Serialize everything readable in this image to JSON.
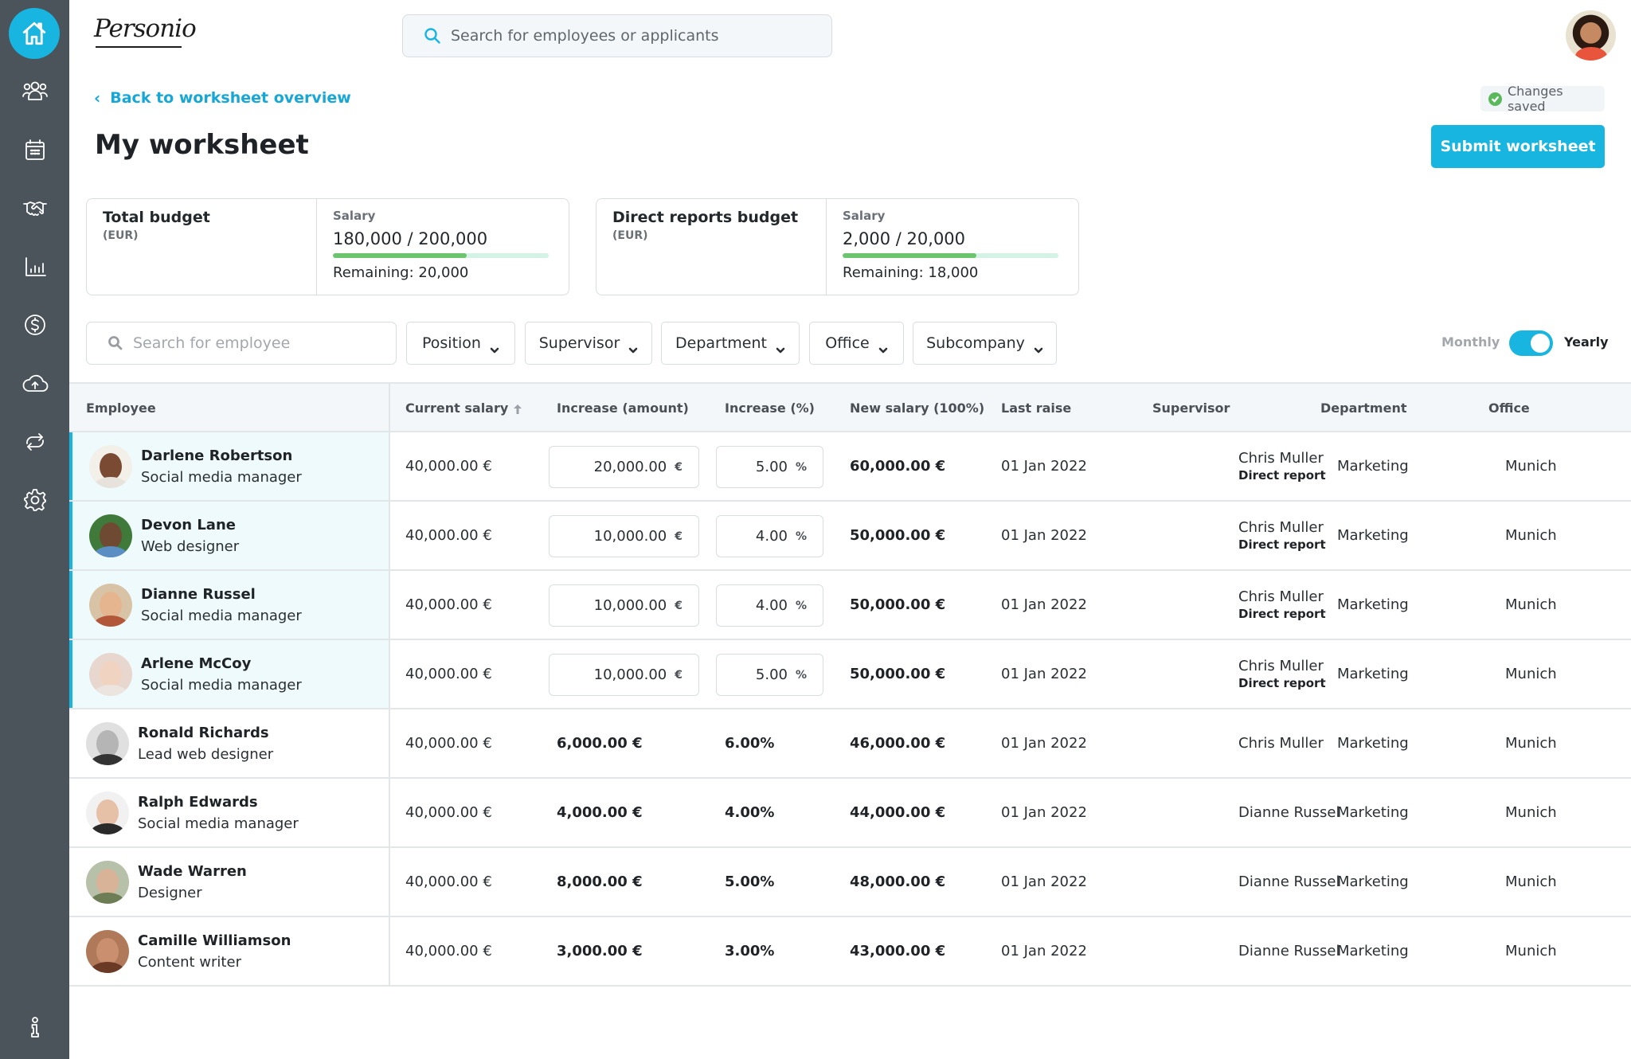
{
  "app": {
    "brand": "Personio",
    "search_placeholder": "Search for employees or applicants"
  },
  "sidebar": {
    "items": [
      {
        "name": "home",
        "icon": "home-icon",
        "active": true
      },
      {
        "name": "employees",
        "icon": "people-icon"
      },
      {
        "name": "calendar",
        "icon": "calendar-icon"
      },
      {
        "name": "recruiting",
        "icon": "handshake-icon"
      },
      {
        "name": "reports",
        "icon": "bar-chart-icon"
      },
      {
        "name": "payroll",
        "icon": "dollar-icon"
      },
      {
        "name": "upload",
        "icon": "cloud-upload-icon"
      },
      {
        "name": "sync",
        "icon": "sync-icon"
      },
      {
        "name": "settings",
        "icon": "gear-icon"
      }
    ],
    "footer_icon": "info-icon"
  },
  "header": {
    "back_label": "Back to worksheet overview",
    "title": "My worksheet",
    "status": "Changes saved",
    "submit_label": "Submit worksheet"
  },
  "budgets": [
    {
      "title": "Total budget",
      "currency": "(EUR)",
      "label": "Salary",
      "value": "180,000 / 200,000",
      "progress_fraction": 0.62,
      "remaining": "Remaining: 20,000"
    },
    {
      "title": "Direct reports budget",
      "currency": "(EUR)",
      "label": "Salary",
      "value": "2,000 / 20,000",
      "progress_fraction": 0.62,
      "remaining": "Remaining: 18,000"
    }
  ],
  "filters": {
    "search_placeholder": "Search for employee",
    "dropdowns": [
      "Position",
      "Supervisor",
      "Department",
      "Office",
      "Subcompany"
    ],
    "period_options": [
      "Monthly",
      "Yearly"
    ],
    "period_selected": "Yearly"
  },
  "table": {
    "columns": [
      "Employee",
      "Current salary",
      "Increase (amount)",
      "Increase (%)",
      "New salary (100%)",
      "Last raise",
      "Supervisor",
      "Department",
      "Office"
    ],
    "sorted_column": "Current salary",
    "sort_direction": "ascending",
    "rows": [
      {
        "name": "Darlene Robertson",
        "role": "Social media manager",
        "current": "40,000.00 €",
        "increase_amount": "20,000.00",
        "increase_pct": "5.00",
        "new_salary": "60,000.00 €",
        "last_raise": "01 Jan 2022",
        "supervisor": "Chris Muller",
        "supervisor_tag": "Direct report",
        "department": "Marketing",
        "office": "Munich",
        "editable": true
      },
      {
        "name": "Devon Lane",
        "role": "Web designer",
        "current": "40,000.00 €",
        "increase_amount": "10,000.00",
        "increase_pct": "4.00",
        "new_salary": "50,000.00 €",
        "last_raise": "01 Jan 2022",
        "supervisor": "Chris Muller",
        "supervisor_tag": "Direct report",
        "department": "Marketing",
        "office": "Munich",
        "editable": true
      },
      {
        "name": "Dianne Russel",
        "role": "Social media manager",
        "current": "40,000.00 €",
        "increase_amount": "10,000.00",
        "increase_pct": "4.00",
        "new_salary": "50,000.00 €",
        "last_raise": "01 Jan 2022",
        "supervisor": "Chris Muller",
        "supervisor_tag": "Direct report",
        "department": "Marketing",
        "office": "Munich",
        "editable": true
      },
      {
        "name": "Arlene McCoy",
        "role": "Social media manager",
        "current": "40,000.00 €",
        "increase_amount": "10,000.00",
        "increase_pct": "5.00",
        "new_salary": "50,000.00 €",
        "last_raise": "01 Jan 2022",
        "supervisor": "Chris Muller",
        "supervisor_tag": "Direct report",
        "department": "Marketing",
        "office": "Munich",
        "editable": true
      },
      {
        "name": "Ronald Richards",
        "role": "Lead web designer",
        "current": "40,000.00 €",
        "increase_amount": "6,000.00 €",
        "increase_pct": "6.00%",
        "new_salary": "46,000.00 €",
        "last_raise": "01 Jan 2022",
        "supervisor": "Chris Muller",
        "supervisor_tag": "",
        "department": "Marketing",
        "office": "Munich",
        "editable": false
      },
      {
        "name": "Ralph Edwards",
        "role": "Social media manager",
        "current": "40,000.00 €",
        "increase_amount": "4,000.00 €",
        "increase_pct": "4.00%",
        "new_salary": "44,000.00 €",
        "last_raise": "01 Jan 2022",
        "supervisor": "Dianne Russel",
        "supervisor_tag": "",
        "department": "Marketing",
        "office": "Munich",
        "editable": false
      },
      {
        "name": "Wade Warren",
        "role": "Designer",
        "current": "40,000.00 €",
        "increase_amount": "8,000.00 €",
        "increase_pct": "5.00%",
        "new_salary": "48,000.00 €",
        "last_raise": "01 Jan 2022",
        "supervisor": "Dianne Russel",
        "supervisor_tag": "",
        "department": "Marketing",
        "office": "Munich",
        "editable": false
      },
      {
        "name": "Camille Williamson",
        "role": "Content writer",
        "current": "40,000.00 €",
        "increase_amount": "3,000.00 €",
        "increase_pct": "3.00%",
        "new_salary": "43,000.00 €",
        "last_raise": "01 Jan 2022",
        "supervisor": "Dianne Russel",
        "supervisor_tag": "",
        "department": "Marketing",
        "office": "Munich",
        "editable": false
      }
    ],
    "units": {
      "amount": "€",
      "percent": "%"
    }
  },
  "colors": {
    "accent": "#17b5e0",
    "sidebar": "#4b535b",
    "progress": "#6cc46f",
    "progress_track": "#d4f3e4",
    "direct_report_row": "#eefafc",
    "saved_check": "#5cb85c"
  }
}
